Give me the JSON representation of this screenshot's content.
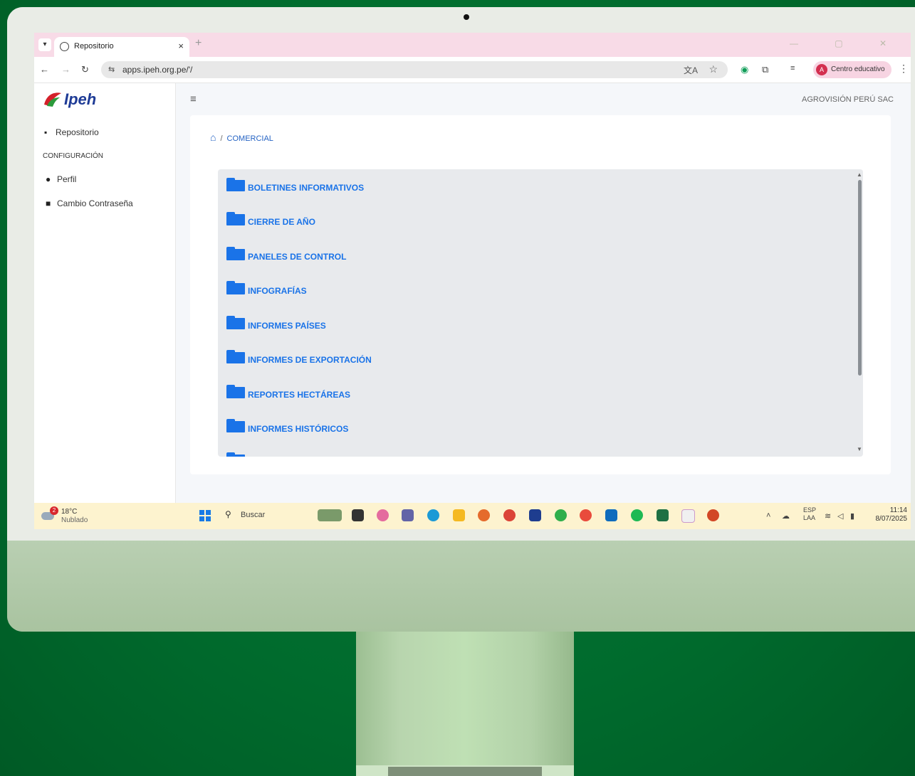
{
  "browser": {
    "tab_title": "Repositorio",
    "tab_close": "×",
    "new_tab": "+",
    "url": "apps.ipeh.org.pe/'/",
    "profile_initial": "A",
    "profile_name": "Centro educativo"
  },
  "app": {
    "logo_text": "Ipeh",
    "company": "AGROVISIÓN PERÚ SAC"
  },
  "sidebar": {
    "repositorio": "Repositorio",
    "section_config": "CONFIGURACIÓN",
    "perfil": "Perfil",
    "cambio": "Cambio Contraseña"
  },
  "breadcrumb": {
    "separator": "/",
    "current": "COMERCIAL"
  },
  "folders": [
    {
      "label": "BOLETINES INFORMATIVOS"
    },
    {
      "label": "CIERRE DE AÑO"
    },
    {
      "label": "PANELES DE CONTROL"
    },
    {
      "label": "INFOGRAFÍAS"
    },
    {
      "label": "INFORMES PAÍSES"
    },
    {
      "label": "INFORMES DE EXPORTACIÓN"
    },
    {
      "label": "REPORTES HECTÁREAS"
    },
    {
      "label": "INFORMES HISTÓRICOS"
    }
  ],
  "taskbar": {
    "weather_badge": "2",
    "weather_temp": "18°C",
    "weather_cond": "Nublado",
    "search_placeholder": "Buscar",
    "lang_top": "ESP",
    "lang_bottom": "LAA",
    "time": "11:14",
    "date": "8/07/2025"
  },
  "colors": {
    "accent": "#1a73e8",
    "background": "#006b2d",
    "tabbar": "#f8dbe7"
  },
  "icons": [
    "globe-icon",
    "back-icon",
    "forward-icon",
    "reload-icon",
    "translate-icon",
    "star-icon",
    "folder-icon",
    "home-icon",
    "user-icon",
    "lock-icon",
    "menu-icon",
    "windows-icon",
    "search-icon"
  ]
}
